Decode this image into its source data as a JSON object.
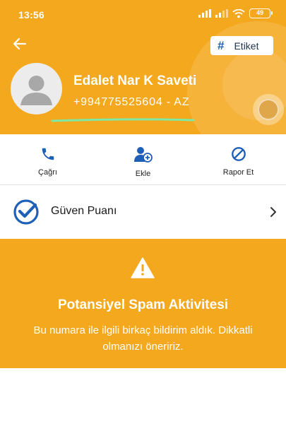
{
  "status_bar": {
    "time": "13:56",
    "battery": "49",
    "icons": [
      "signal-icon",
      "signal-icon",
      "wifi-icon",
      "battery-icon"
    ]
  },
  "header": {
    "back_icon": "arrow-left-icon",
    "tag_button": {
      "icon": "hash",
      "label": "Etiket"
    },
    "contact_name": "Edalet Nar K Saveti",
    "phone_number": "+994775525604 - AZ",
    "background_color": "#f4a81d"
  },
  "actions": [
    {
      "label": "Çağrı",
      "icon": "phone-icon"
    },
    {
      "label": "Ekle",
      "icon": "add-contact-icon"
    },
    {
      "label": "Rapor Et",
      "icon": "block-icon"
    }
  ],
  "trust_score": {
    "label": "Güven Puanı",
    "icon": "check-badge-icon",
    "chevron": "chevron-right-icon"
  },
  "spam_warning": {
    "title": "Potansiyel Spam Aktivitesi",
    "description": "Bu numara ile ilgili birkaç bildirim aldık. Dikkatli olmanızı öneririz.",
    "icon": "warning-icon",
    "background_color": "#f4a81d"
  },
  "colors": {
    "accent": "#f4a81d",
    "blue": "#1e5fb8",
    "highlight": "#7de9a5"
  }
}
